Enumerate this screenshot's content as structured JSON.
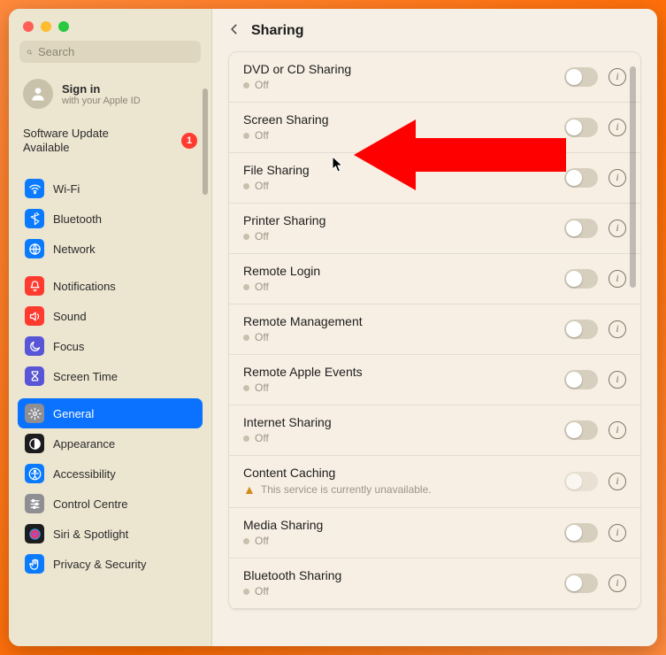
{
  "window": {
    "search_placeholder": "Search",
    "signin_title": "Sign in",
    "signin_subtitle": "with your Apple ID",
    "update_text_line1": "Software Update",
    "update_text_line2": "Available",
    "update_badge": "1"
  },
  "sidebar_groups": [
    {
      "items": [
        {
          "key": "wifi",
          "label": "Wi-Fi",
          "bg": "#0a7bff"
        },
        {
          "key": "bluetooth",
          "label": "Bluetooth",
          "bg": "#0a7bff"
        },
        {
          "key": "network",
          "label": "Network",
          "bg": "#0a7bff"
        }
      ]
    },
    {
      "items": [
        {
          "key": "notifications",
          "label": "Notifications",
          "bg": "#ff3b30"
        },
        {
          "key": "sound",
          "label": "Sound",
          "bg": "#ff3b30"
        },
        {
          "key": "focus",
          "label": "Focus",
          "bg": "#5856d6"
        },
        {
          "key": "screentime",
          "label": "Screen Time",
          "bg": "#5856d6"
        }
      ]
    },
    {
      "items": [
        {
          "key": "general",
          "label": "General",
          "bg": "#8e8e93",
          "selected": true
        },
        {
          "key": "appearance",
          "label": "Appearance",
          "bg": "#1c1c1e"
        },
        {
          "key": "accessibility",
          "label": "Accessibility",
          "bg": "#0a7bff"
        },
        {
          "key": "controlcentre",
          "label": "Control Centre",
          "bg": "#8e8e93"
        },
        {
          "key": "siri",
          "label": "Siri & Spotlight",
          "bg": "#1c1c1e"
        },
        {
          "key": "privacy",
          "label": "Privacy & Security",
          "bg": "#0a7bff"
        }
      ]
    }
  ],
  "header": {
    "title": "Sharing"
  },
  "services": [
    {
      "key": "dvd",
      "title": "DVD or CD Sharing",
      "status": "Off"
    },
    {
      "key": "screen",
      "title": "Screen Sharing",
      "status": "Off"
    },
    {
      "key": "file",
      "title": "File Sharing",
      "status": "Off"
    },
    {
      "key": "printer",
      "title": "Printer Sharing",
      "status": "Off"
    },
    {
      "key": "remotelogin",
      "title": "Remote Login",
      "status": "Off"
    },
    {
      "key": "remotemgmt",
      "title": "Remote Management",
      "status": "Off"
    },
    {
      "key": "remoteapple",
      "title": "Remote Apple Events",
      "status": "Off"
    },
    {
      "key": "internet",
      "title": "Internet Sharing",
      "status": "Off"
    },
    {
      "key": "content",
      "title": "Content Caching",
      "status": "This service is currently unavailable.",
      "warn": true,
      "disabled": true
    },
    {
      "key": "media",
      "title": "Media Sharing",
      "status": "Off"
    },
    {
      "key": "btshare",
      "title": "Bluetooth Sharing",
      "status": "Off"
    }
  ],
  "icons": {
    "wifi": "wifi",
    "bluetooth": "bt",
    "network": "globe",
    "notifications": "bell",
    "sound": "speaker",
    "focus": "moon",
    "screentime": "hourglass",
    "general": "gear",
    "appearance": "appearance",
    "accessibility": "access",
    "controlcentre": "sliders",
    "siri": "siri",
    "privacy": "hand"
  }
}
